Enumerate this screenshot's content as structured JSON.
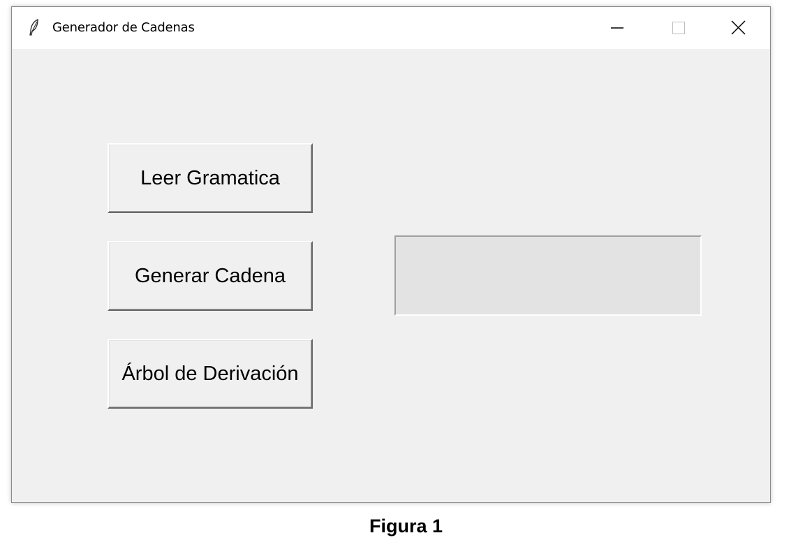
{
  "window": {
    "title": "Generador de Cadenas",
    "icon": "feather-icon",
    "controls": {
      "minimize_icon": "minimize-icon",
      "maximize_icon": "maximize-icon",
      "close_icon": "close-icon"
    }
  },
  "buttons": {
    "read_grammar": "Leer Gramatica",
    "generate_string": "Generar Cadena",
    "derivation_tree": "Árbol de Derivación"
  },
  "output": {
    "value": ""
  },
  "caption": "Figura 1",
  "colors": {
    "window_bg": "#f0f0f0",
    "titlebar_bg": "#ffffff",
    "output_bg": "#e3e3e3"
  }
}
